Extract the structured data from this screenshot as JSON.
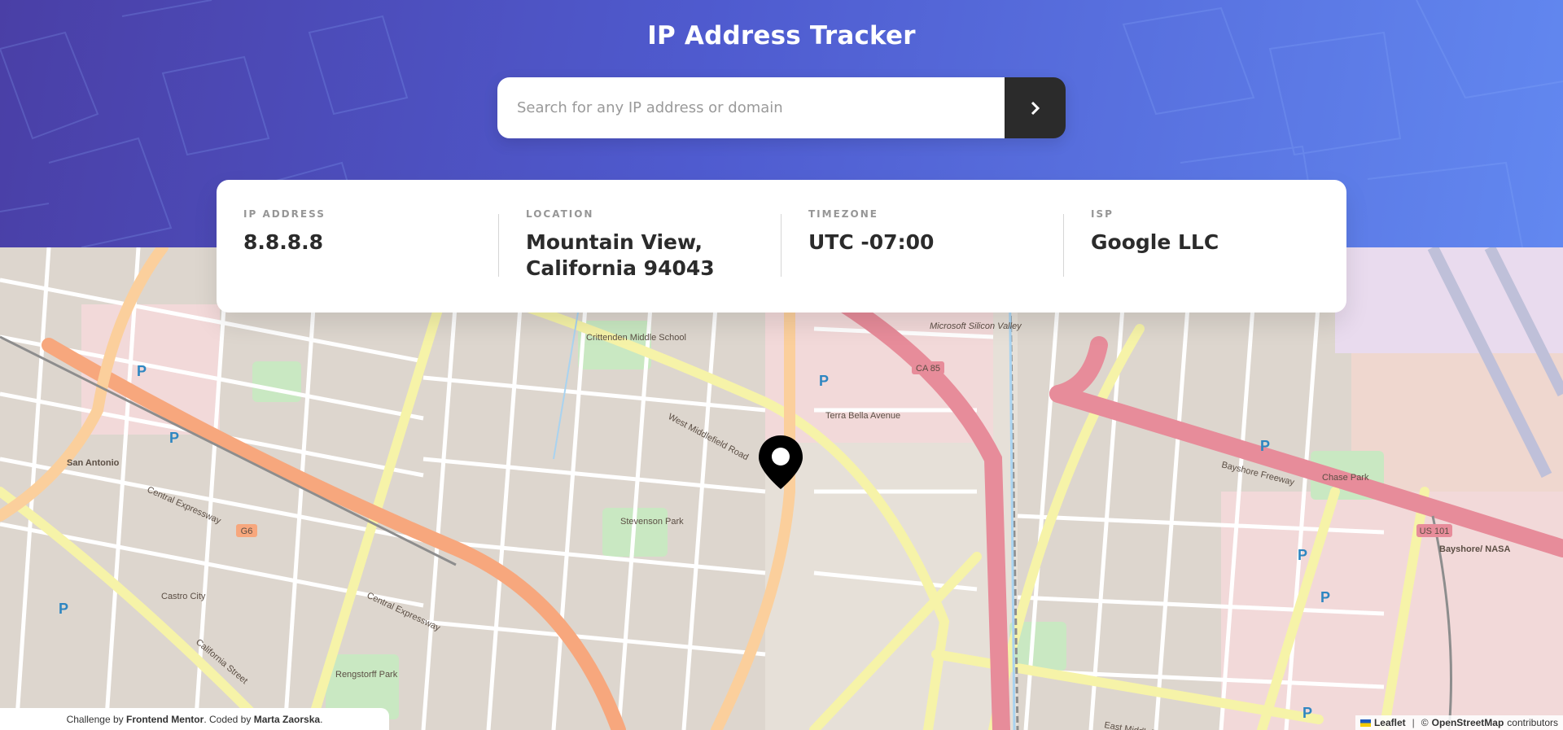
{
  "header": {
    "title": "IP Address Tracker"
  },
  "search": {
    "placeholder": "Search for any IP address or domain",
    "value": "",
    "button_icon": "chevron-right-icon"
  },
  "info": {
    "ip": {
      "label": "IP ADDRESS",
      "value": "8.8.8.8"
    },
    "location": {
      "label": "LOCATION",
      "line1": "Mountain View,",
      "line2": "California 94043"
    },
    "timezone": {
      "label": "TIMEZONE",
      "value": "UTC -07:00"
    },
    "isp": {
      "label": "ISP",
      "value": "Google LLC"
    }
  },
  "map": {
    "labels": {
      "san_antonio": "San Antonio",
      "castro_city": "Castro City",
      "west_middlefield": "West Middlefield Road",
      "central_expressway": "Central Expressway",
      "crittenden": "Crittenden Middle School",
      "microsoft": "Microsoft Silicon Valley",
      "stevenson_park": "Stevenson Park",
      "rengstorff_park": "Rengstorff Park",
      "chase_park": "Chase Park",
      "bayshore": "Bayshore Freeway",
      "bayshore_nasa": "Bayshore/ NASA",
      "ca85": "CA 85",
      "us101": "US 101",
      "g6": "G6",
      "terra_bella": "Terra Bella Avenue",
      "california_street": "California Street",
      "east_middlefield": "East Middlefield"
    },
    "marker_icon": "location-pin-icon",
    "attribution": {
      "leaflet": "Leaflet",
      "separator": "|",
      "osm_prefix": "©",
      "osm": "OpenStreetMap",
      "osm_suffix": "contributors"
    }
  },
  "credit": {
    "prefix": "Challenge by",
    "frontend_mentor": "Frontend Mentor",
    "middle": ". Coded by",
    "author": "Marta Zaorska",
    "suffix": "."
  },
  "colors": {
    "header_start": "#4a3fa6",
    "header_end": "#6288f0",
    "dark": "#2b2b2b",
    "gray_label": "#969696"
  }
}
